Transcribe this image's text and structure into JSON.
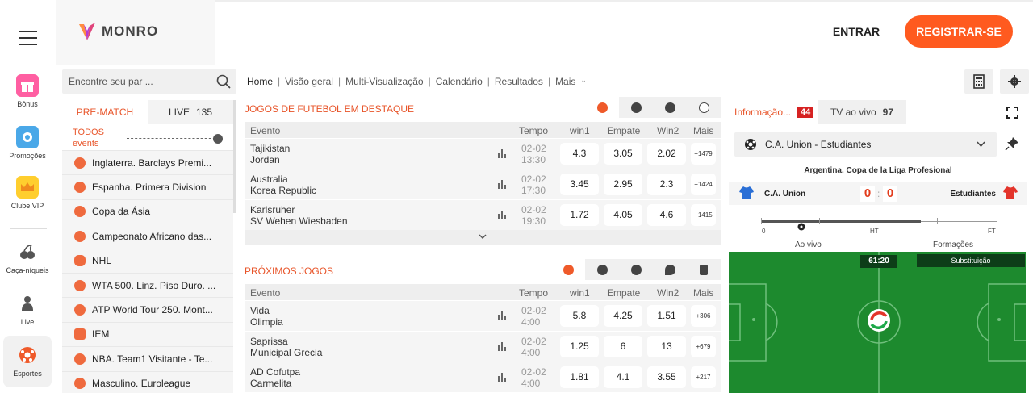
{
  "rail": [
    {
      "label": "Bônus",
      "icon": "gift-icon"
    },
    {
      "label": "Promoções",
      "icon": "promo-icon"
    },
    {
      "label": "Clube VIP",
      "icon": "crown-icon"
    },
    {
      "label": "Caça-níqueis",
      "icon": "cherry-icon"
    },
    {
      "label": "Live",
      "icon": "dealer-icon"
    },
    {
      "label": "Esportes",
      "icon": "soccer-ball-icon"
    }
  ],
  "brand": {
    "name": "MONRO",
    "accent": "#ff5a1f"
  },
  "header": {
    "enter": "ENTRAR",
    "register": "REGISTRAR-SE"
  },
  "search": {
    "placeholder": "Encontre seu par ..."
  },
  "left_tabs": {
    "prematch": "PRE-MATCH",
    "live": "LIVE",
    "live_count": "135"
  },
  "all_events": {
    "line1": "TODOS",
    "line2": "events"
  },
  "leagues": [
    "Inglaterra. Barclays Premi...",
    "Espanha. Primera Division",
    "Copa da Ásia",
    "Campeonato Africano das...",
    "NHL",
    "WTA 500. Linz. Piso Duro. ...",
    "ATP World Tour 250. Mont...",
    "IEM",
    "NBA. Team1 Visitante - Te...",
    "Masculino. Euroleague"
  ],
  "breadcrumb": {
    "home": "Home",
    "overview": "Visão geral",
    "multi": "Multi-Visualização",
    "calendar": "Calendário",
    "results": "Resultados",
    "more": "Mais"
  },
  "featured": {
    "title": "JOGOS DE FUTEBOL EM DESTAQUE",
    "headers": {
      "event": "Evento",
      "time": "Tempo",
      "win1": "win1",
      "draw": "Empate",
      "win2": "Win2",
      "more": "Mais"
    },
    "rows": [
      {
        "team1": "Tajikistan",
        "team2": "Jordan",
        "date": "02-02",
        "hour": "13:30",
        "w1": "4.3",
        "x": "3.05",
        "w2": "2.02",
        "more": "+1479"
      },
      {
        "team1": "Australia",
        "team2": "Korea Republic",
        "date": "02-02",
        "hour": "17:30",
        "w1": "3.45",
        "x": "2.95",
        "w2": "2.3",
        "more": "+1424"
      },
      {
        "team1": "Karlsruher",
        "team2": "SV Wehen Wiesbaden",
        "date": "02-02",
        "hour": "19:30",
        "w1": "1.72",
        "x": "4.05",
        "w2": "4.6",
        "more": "+1415"
      }
    ]
  },
  "upcoming": {
    "title": "PRÓXIMOS JOGOS",
    "headers": {
      "event": "Evento",
      "time": "Tempo",
      "win1": "win1",
      "draw": "Empate",
      "win2": "Win2",
      "more": "Mais"
    },
    "rows": [
      {
        "team1": "Vida",
        "team2": "Olimpia",
        "date": "02-02",
        "hour": "4:00",
        "w1": "5.8",
        "x": "4.25",
        "w2": "1.51",
        "more": "+306"
      },
      {
        "team1": "Saprissa",
        "team2": "Municipal Grecia",
        "date": "02-02",
        "hour": "4:00",
        "w1": "1.25",
        "x": "6",
        "w2": "13",
        "more": "+679"
      },
      {
        "team1": "AD Cofutpa",
        "team2": "Carmelita",
        "date": "02-02",
        "hour": "4:00",
        "w1": "1.81",
        "x": "4.1",
        "w2": "3.55",
        "more": "+217"
      }
    ]
  },
  "right": {
    "info_tab": "Informação...",
    "info_count": "44",
    "tv_tab": "TV ao vivo",
    "tv_count": "97",
    "match": "C.A. Union - Estudiantes",
    "tournament": "Argentina. Copa de la Liga Profesional",
    "home": "C.A. Union",
    "away": "Estudiantes",
    "score_home": "0",
    "score_away": "0",
    "score_sep": ":",
    "tl_start": "0",
    "tl_ht": "HT",
    "tl_ft": "FT",
    "live_label": "Ao vivo",
    "formations_label": "Formações",
    "clock": "61:20",
    "event": "Substituição"
  }
}
